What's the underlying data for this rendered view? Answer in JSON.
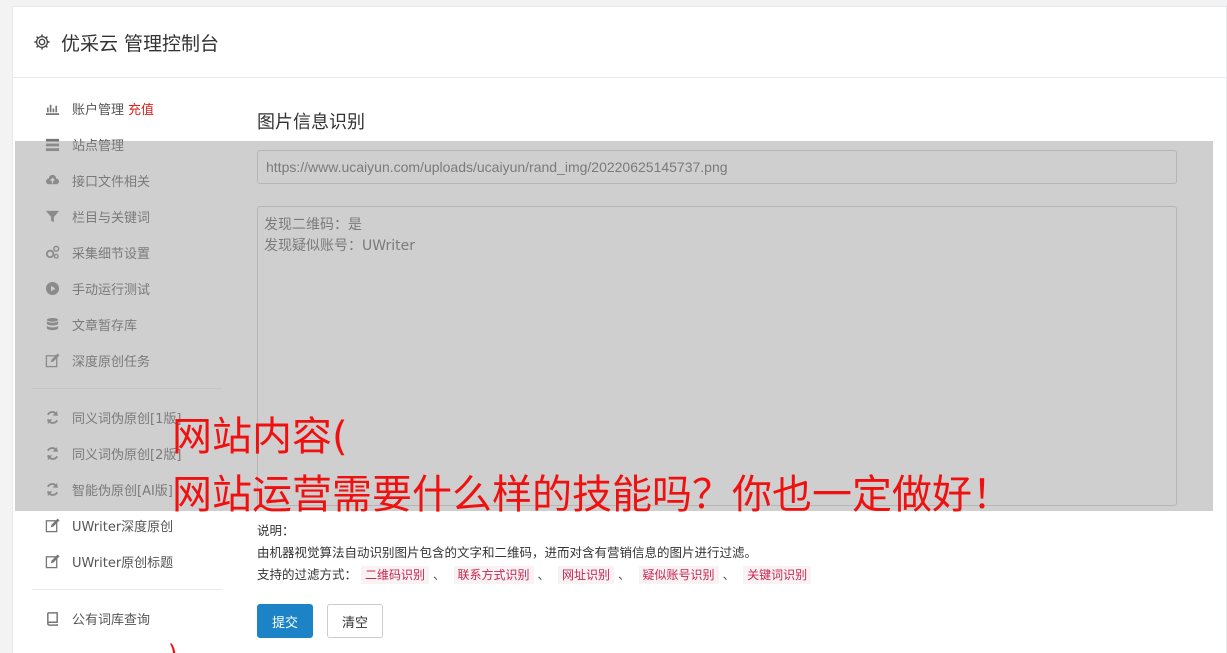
{
  "header": {
    "title": "优采云 管理控制台",
    "icon": "gear-icon"
  },
  "sidebar": {
    "items": [
      {
        "label": "账户管理",
        "accent": "充值",
        "icon": "bar-chart-icon"
      },
      {
        "label": "站点管理",
        "icon": "server-icon"
      },
      {
        "label": "接口文件相关",
        "icon": "cloud-upload-icon"
      },
      {
        "label": "栏目与关键词",
        "icon": "filter-icon"
      },
      {
        "label": "采集细节设置",
        "icon": "gears-icon"
      },
      {
        "label": "手动运行测试",
        "icon": "play-circle-icon"
      },
      {
        "label": "文章暂存库",
        "icon": "database-icon"
      },
      {
        "label": "深度原创任务",
        "icon": "edit-icon"
      },
      {
        "label": "同义词伪原创[1版]",
        "icon": "refresh-icon"
      },
      {
        "label": "同义词伪原创[2版]",
        "icon": "refresh-icon"
      },
      {
        "label": "智能伪原创[AI版]",
        "icon": "refresh-icon"
      },
      {
        "label": "UWriter深度原创",
        "icon": "edit-icon"
      },
      {
        "label": "UWriter原创标题",
        "icon": "edit-icon"
      },
      {
        "label": "公有词库查询",
        "icon": "book-icon"
      }
    ]
  },
  "main": {
    "section_title": "图片信息识别",
    "url_value": "https://www.ucaiyun.com/uploads/ucaiyun/rand_img/20220625145737.png",
    "result_line1": "发现二维码：是",
    "result_line2": "发现疑似账号：UWriter",
    "notes_label": "说明：",
    "notes_desc": "由机器视觉算法自动识别图片包含的文字和二维码，进而对含有营销信息的图片进行过滤。",
    "filter_label": "支持的过滤方式：",
    "filters": [
      "二维码识别",
      "联系方式识别",
      "网址识别",
      "疑似账号识别",
      "关键词识别"
    ],
    "filter_sep": "、",
    "submit_label": "提交",
    "clear_label": "清空"
  },
  "overlay": {
    "line1": "网站内容(",
    "line2": "网站运营需要什么样的技能吗？你也一定做好！",
    "stray": ")"
  },
  "colors": {
    "accent_red": "#e02020",
    "primary": "#1c84c6",
    "overlay_text": "#f01010"
  }
}
